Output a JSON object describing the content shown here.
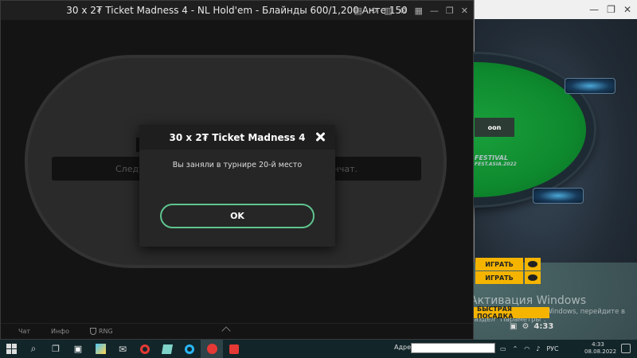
{
  "main_window": {
    "title": "30 x 2₮ Ticket Madness 4 - NL Hold'em - Блайнды 600/1,200 Анте 150",
    "banner_left": "Следу",
    "banner_right": "нчат.",
    "tabs": [
      "Чат",
      "Инфо",
      "RNG"
    ]
  },
  "modal": {
    "title": "30 x 2₮ Ticket Madness 4",
    "message": "Вы заняли в турнире 20-й место",
    "ok_label": "OK"
  },
  "second_window": {
    "felt_label": "oon",
    "logo_text": "FESTIVAL",
    "logo_sub": "FEST.ASIA.2022",
    "play_buttons": [
      "ИГРАТЬ",
      "ИГРАТЬ"
    ],
    "quick_seat": "БЫСТРАЯ ПОСАДКА",
    "mini_time": "4:33"
  },
  "activation": {
    "title": "Активация Windows",
    "subtitle": "Чтобы активировать Windows, перейдите в раздел \"Параметры\"."
  },
  "taskbar": {
    "address_label": "Адрес",
    "address_value": "",
    "lang": "РУС",
    "time": "4:33",
    "date": "08.08.2022"
  },
  "colors": {
    "accent_green": "#5ec48f",
    "felt_green": "#0e8a2e",
    "lobby_yellow": "#f4b400"
  }
}
